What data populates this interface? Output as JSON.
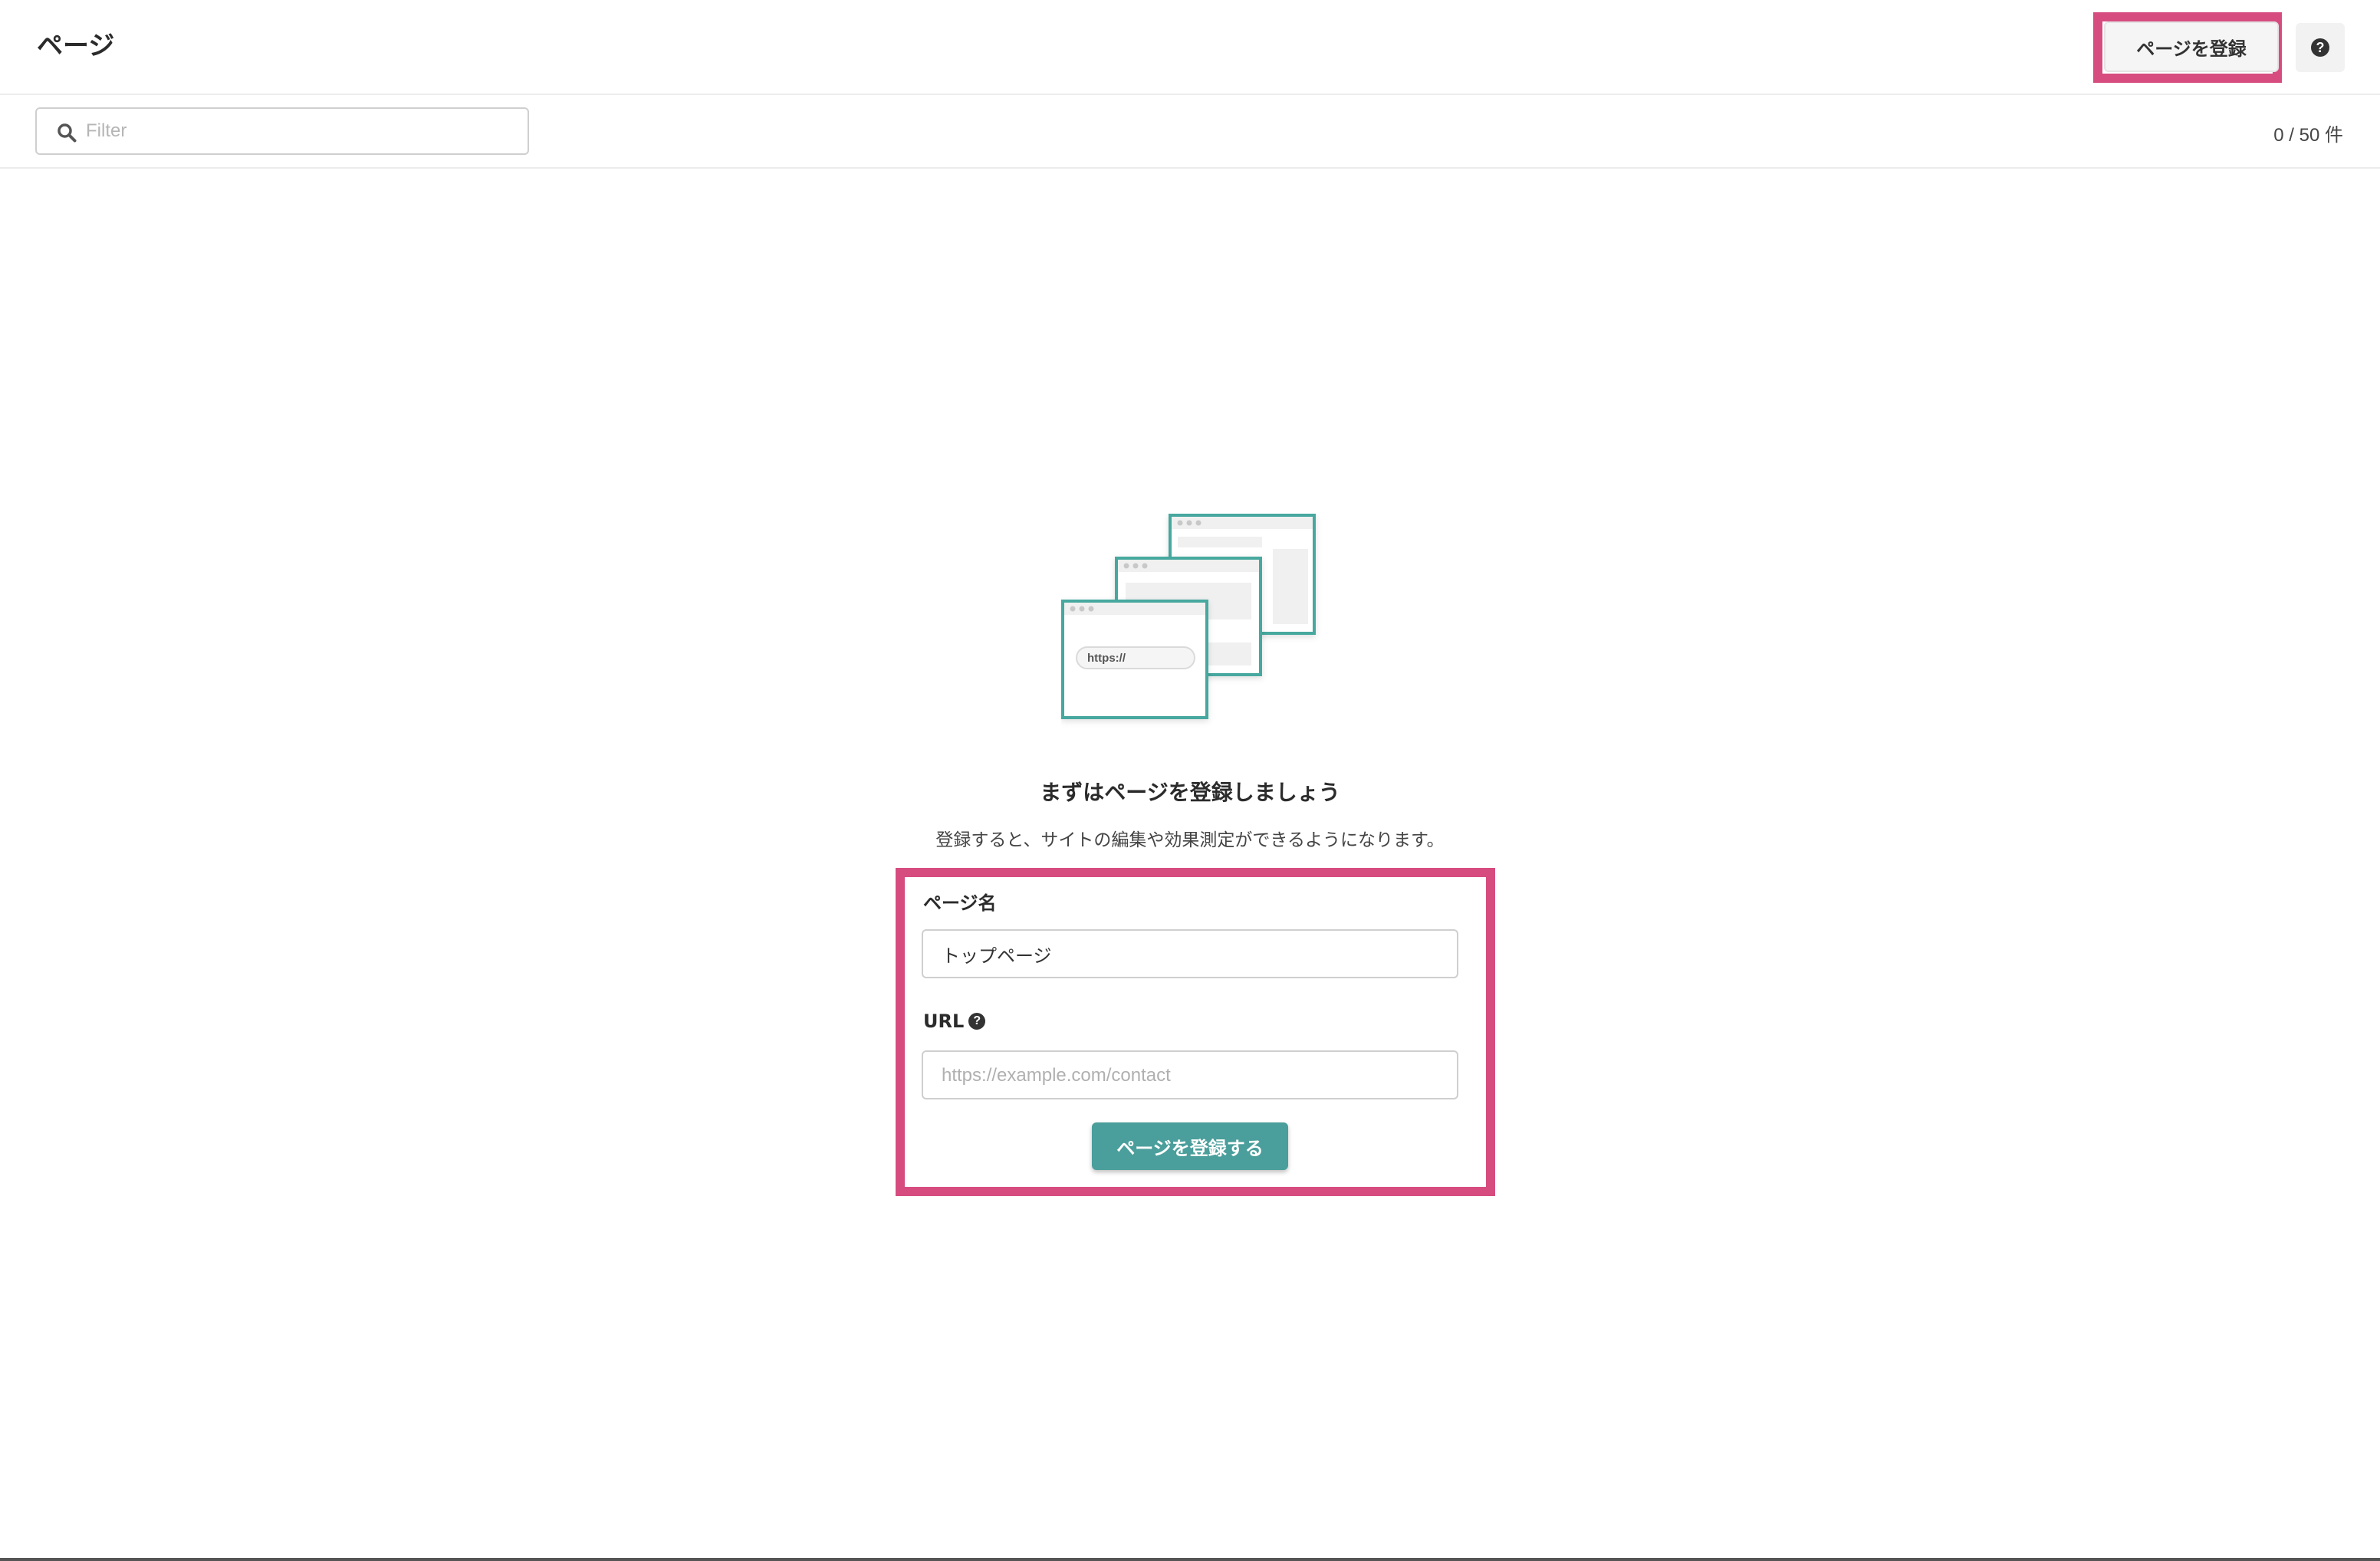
{
  "header": {
    "title": "ページ",
    "register_label": "ページを登録"
  },
  "filter": {
    "placeholder": "Filter",
    "count": "0 / 50 件"
  },
  "illustration": {
    "url_text": "https://"
  },
  "empty_state": {
    "title": "まずはページを登録しましょう",
    "subtitle": "登録すると、サイトの編集や効果測定ができるようになります。"
  },
  "form": {
    "name_label": "ページ名",
    "name_value": "トップページ",
    "url_label": "URL",
    "url_placeholder": "https://example.com/contact",
    "submit_label": "ページを登録する"
  },
  "colors": {
    "highlight": "#d64c7f",
    "accent": "#4a9e9b",
    "illustration_stroke": "#46a89f"
  },
  "icons": [
    "search-icon",
    "help-icon",
    "browser-windows-illustration"
  ]
}
